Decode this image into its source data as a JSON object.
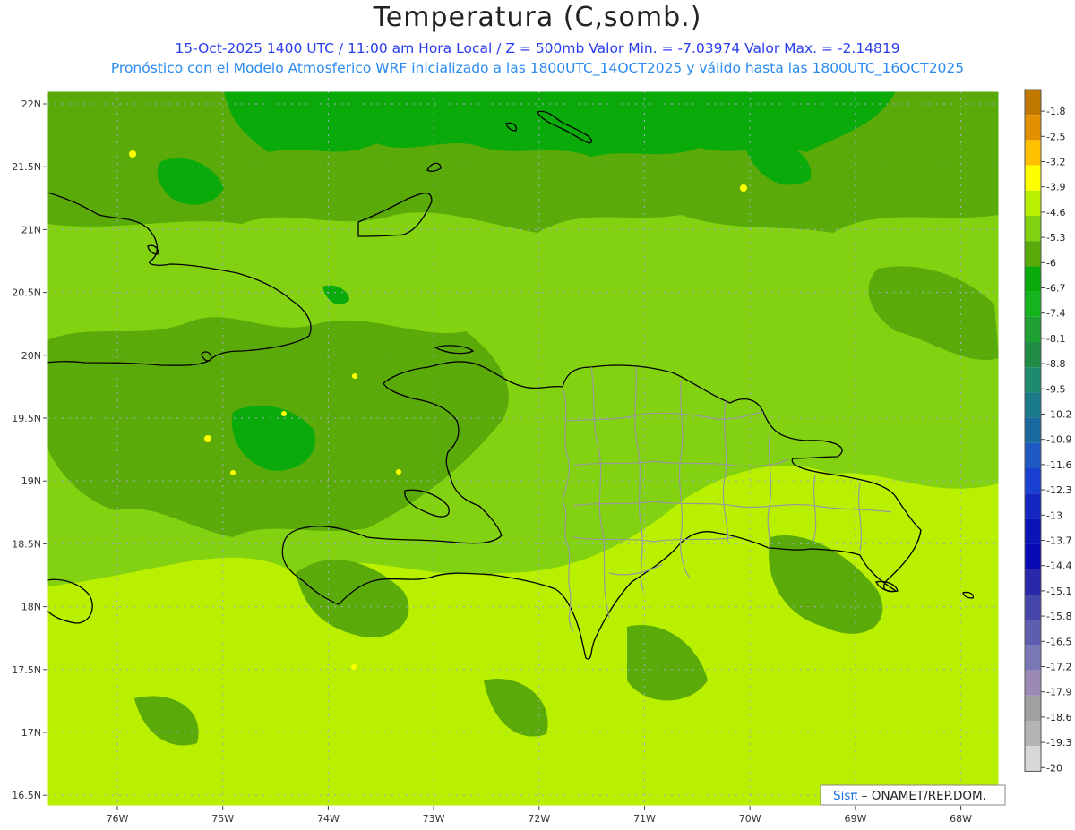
{
  "header": {
    "title": "Temperatura (C,somb.)",
    "line1": "15-Oct-2025  1400 UTC / 11:00 am Hora Local / Z = 500mb  Valor Min. = -7.03974  Valor Max. = -2.14819",
    "line2": "Pronóstico con el Modelo Atmosferico WRF inicializado a las 1800UTC_14OCT2025 y válido hasta las  1800UTC_16OCT2025"
  },
  "map": {
    "lat_labels": [
      "22N",
      "21.5N",
      "21N",
      "20.5N",
      "20N",
      "19.5N",
      "19N",
      "18.5N",
      "18N",
      "17.5N",
      "17N",
      "16.5N"
    ],
    "lon_labels": [
      "76W",
      "75W",
      "74W",
      "73W",
      "72W",
      "71W",
      "70W",
      "69W",
      "68W"
    ],
    "base_color": "#82d212",
    "watermark": {
      "brand": "Sisπ",
      "rest": " – ONAMET/REP.DOM."
    }
  },
  "colorbar": {
    "labels": [
      "-1.8",
      "-2.5",
      "-3.2",
      "-3.9",
      "-4.6",
      "-5.3",
      "-6",
      "-6.7",
      "-7.4",
      "-8.1",
      "-8.8",
      "-9.5",
      "-10.2",
      "-10.9",
      "-11.6",
      "-12.3",
      "-13",
      "-13.7",
      "-14.4",
      "-15.1",
      "-15.8",
      "-16.5",
      "-17.2",
      "-17.9",
      "-18.6",
      "-19.3",
      "-20"
    ],
    "colors": [
      "#c07800",
      "#e09000",
      "#ffc000",
      "#ffff00",
      "#b8f000",
      "#82d212",
      "#5aaa0a",
      "#0aaa0a",
      "#14b41e",
      "#1ea032",
      "#208c46",
      "#1e8a6e",
      "#1a7a8a",
      "#1a6aa0",
      "#1e58c0",
      "#1a40d2",
      "#1426c2",
      "#0a14b4",
      "#0a0ab4",
      "#2828a8",
      "#4646aa",
      "#5e5eb0",
      "#7a78b4",
      "#9a8ab4",
      "#a0a0a0",
      "#b4b4b4",
      "#d8d8d8"
    ]
  }
}
